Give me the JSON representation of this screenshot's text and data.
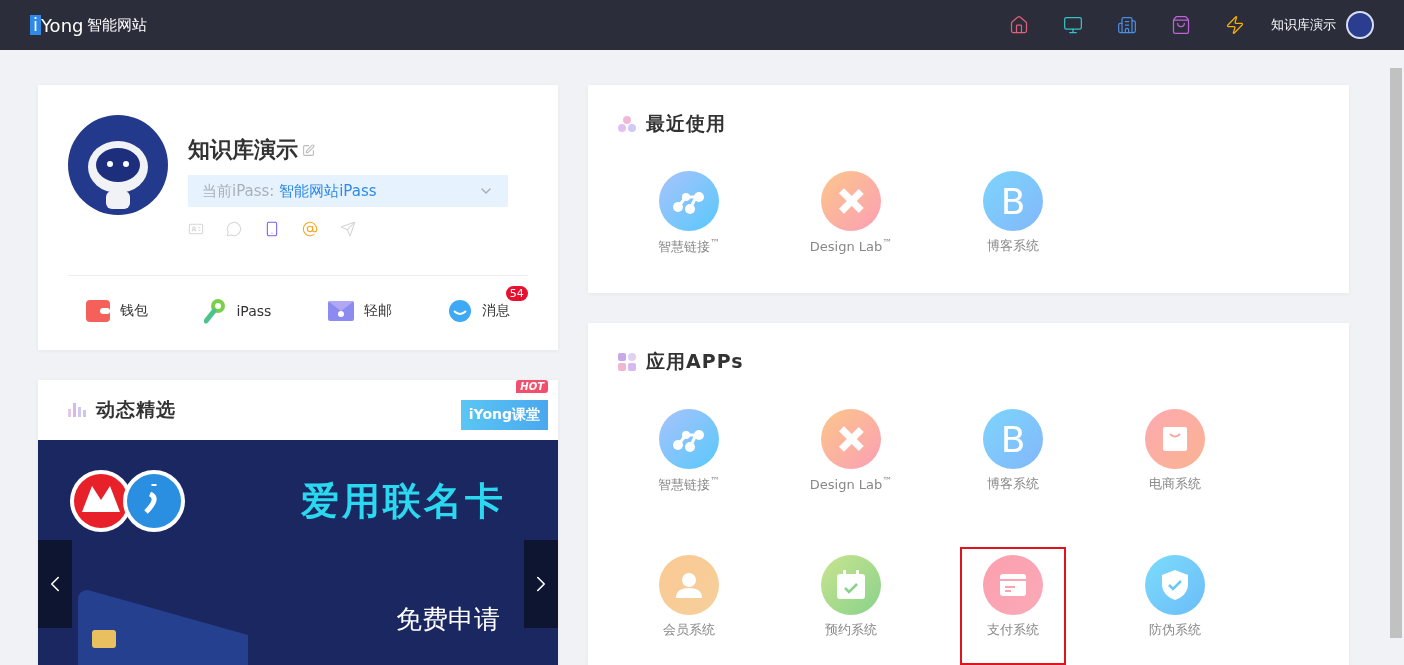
{
  "header": {
    "logo": {
      "mark": "i",
      "name": "Yong",
      "subtitle": "智能网站"
    },
    "nav": [
      {
        "kind": "home"
      },
      {
        "kind": "monitor"
      },
      {
        "kind": "building"
      },
      {
        "kind": "bag"
      },
      {
        "kind": "bolt"
      }
    ],
    "user": "知识库演示"
  },
  "profile": {
    "name": "知识库演示",
    "ipass": {
      "label": "当前iPass: ",
      "value": "智能网站iPass"
    },
    "bindings": [
      {
        "kind": "idcard",
        "bound": false
      },
      {
        "kind": "wechat",
        "bound": false
      },
      {
        "kind": "phone",
        "bound": true
      },
      {
        "kind": "email",
        "bound": true
      },
      {
        "kind": "plane",
        "bound": false
      }
    ],
    "links": [
      {
        "kind": "wallet",
        "label": "钱包"
      },
      {
        "kind": "key",
        "label": "iPass"
      },
      {
        "kind": "mail",
        "label": "轻邮"
      },
      {
        "kind": "chat",
        "label": "消息",
        "badge": "54"
      }
    ]
  },
  "feed": {
    "title": "动态精选",
    "course": {
      "label": "iYong课堂",
      "tag": "HOT"
    },
    "banner": {
      "headline": "爱用联名卡",
      "action": "免费申请"
    }
  },
  "recent": {
    "title": "最近使用",
    "apps": [
      {
        "kind": "nodes",
        "label": "智慧链接$^{™}$",
        "highlighted": false
      },
      {
        "kind": "design",
        "label": "Design Lab$^{™}$",
        "highlighted": false
      },
      {
        "kind": "letter",
        "glyph": "B",
        "label": "博客系统",
        "highlighted": false
      }
    ]
  },
  "apps": {
    "title": "应用APPs",
    "apps": [
      {
        "kind": "nodes",
        "label": "智慧链接$^{™}$",
        "highlighted": false
      },
      {
        "kind": "design",
        "label": "Design Lab$^{™}$",
        "highlighted": false
      },
      {
        "kind": "letter",
        "glyph": "B",
        "label": "博客系统",
        "highlighted": false
      },
      {
        "kind": "shop",
        "label": "电商系统",
        "highlighted": false
      },
      {
        "kind": "member",
        "label": "会员系统",
        "highlighted": false
      },
      {
        "kind": "booking",
        "label": "预约系统",
        "highlighted": false
      },
      {
        "kind": "payment",
        "label": "支付系统",
        "highlighted": true
      },
      {
        "kind": "security",
        "label": "防伪系统",
        "highlighted": false
      }
    ]
  }
}
